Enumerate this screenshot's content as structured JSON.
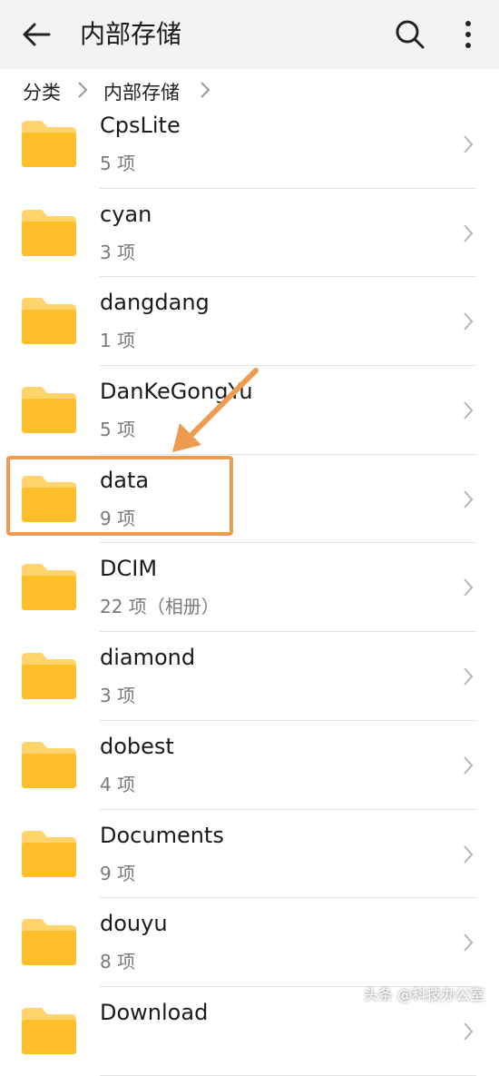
{
  "header": {
    "title": "内部存储",
    "back_icon": "back-arrow-icon",
    "search_icon": "search-icon",
    "more_icon": "more-vertical-icon",
    "bg_color": "#f3f3f3"
  },
  "breadcrumb": {
    "items": [
      "分类",
      "内部存储"
    ]
  },
  "folders": [
    {
      "name": "CpsLite",
      "count": "5 项"
    },
    {
      "name": "cyan",
      "count": "3 项"
    },
    {
      "name": "dangdang",
      "count": "1 项"
    },
    {
      "name": "DanKeGongYu",
      "count": "5 项"
    },
    {
      "name": "data",
      "count": "9 项"
    },
    {
      "name": "DCIM",
      "count": "22 项（相册）"
    },
    {
      "name": "diamond",
      "count": "3 项"
    },
    {
      "name": "dobest",
      "count": "4 项"
    },
    {
      "name": "Documents",
      "count": "9 项"
    },
    {
      "name": "douyu",
      "count": "8 项"
    },
    {
      "name": "Download",
      "count": ""
    }
  ],
  "annotation": {
    "highlighted_folder": "data",
    "color": "#ee9a4f"
  },
  "watermark": "头条 @科技办公室",
  "colors": {
    "folder_front": "#ffbf2a",
    "folder_back": "#ffd56b",
    "text": "#1a1a1a",
    "secondary_text": "#7a7a7a"
  }
}
